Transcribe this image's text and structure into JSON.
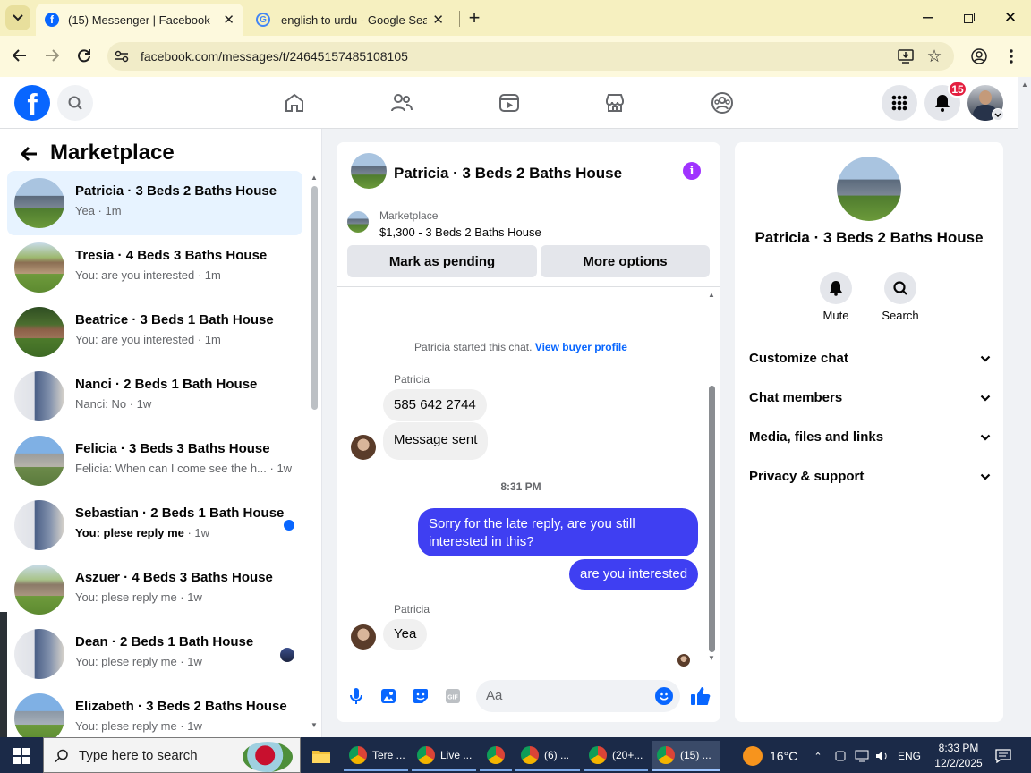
{
  "browser": {
    "tabs": [
      {
        "title": "(15) Messenger | Facebook"
      },
      {
        "title": "english to urdu - Google Search"
      }
    ],
    "url": "facebook.com/messages/t/24645157485108105"
  },
  "header": {
    "notif_count": "15"
  },
  "left": {
    "title": "Marketplace",
    "conversations": [
      {
        "name": "Patricia · 3 Beds 2 Baths House",
        "preview": "Yea · 1m"
      },
      {
        "name": "Tresia · 4 Beds 3 Baths House",
        "preview": "You: are you interested · 1m"
      },
      {
        "name": "Beatrice · 3 Beds 1 Bath House",
        "preview": "You: are you interested · 1m"
      },
      {
        "name": "Nanci · 2 Beds 1 Bath House",
        "preview": "Nanci: No · 1w"
      },
      {
        "name": "Felicia · 3 Beds 3 Baths House",
        "preview": "Felicia: When can I come see the h...",
        "time": "· 1w"
      },
      {
        "name": "Sebastian · 2 Beds 1 Bath House",
        "preview": "You: plese reply me",
        "time": "· 1w"
      },
      {
        "name": "Aszuer · 4 Beds 3 Baths House",
        "preview": "You: plese reply me · 1w"
      },
      {
        "name": "Dean · 2 Beds 1 Bath House",
        "preview": "You: plese reply me · 1w"
      },
      {
        "name": "Elizabeth · 3 Beds 2 Baths House",
        "preview": "You: plese reply me · 1w"
      }
    ]
  },
  "chat": {
    "title": "Patricia · 3 Beds 2 Baths House",
    "listing_label": "Marketplace",
    "listing_detail": "$1,300 - 3 Beds 2 Baths House",
    "mark_pending": "Mark as pending",
    "more_options": "More options",
    "started_text": "Patricia started this chat.",
    "view_profile": "View buyer profile",
    "sender1": "Patricia",
    "msg1": "585 642 2744",
    "msg2": "Message sent",
    "time_sep": "8:31 PM",
    "out1": "Sorry for the late reply, are you still interested in this?",
    "out2": "are you interested",
    "sender2": "Patricia",
    "msg3": "Yea",
    "composer_placeholder": "Aa"
  },
  "right": {
    "name": "Patricia · 3 Beds 2 Baths House",
    "mute": "Mute",
    "search": "Search",
    "sections": [
      "Customize chat",
      "Chat members",
      "Media, files and links",
      "Privacy & support"
    ]
  },
  "taskbar": {
    "search_placeholder": "Type here to search",
    "apps": [
      "Tere ...",
      "Live ...",
      "(6) ...",
      "(20+...",
      "(15) ..."
    ],
    "weather": "16°C",
    "lang": "ENG",
    "time": "8:33 PM",
    "date": "12/2/2025"
  },
  "colors": {
    "accent": "#0866ff",
    "bubble_out": "#3f3ff2",
    "badge": "#e41e3f"
  }
}
